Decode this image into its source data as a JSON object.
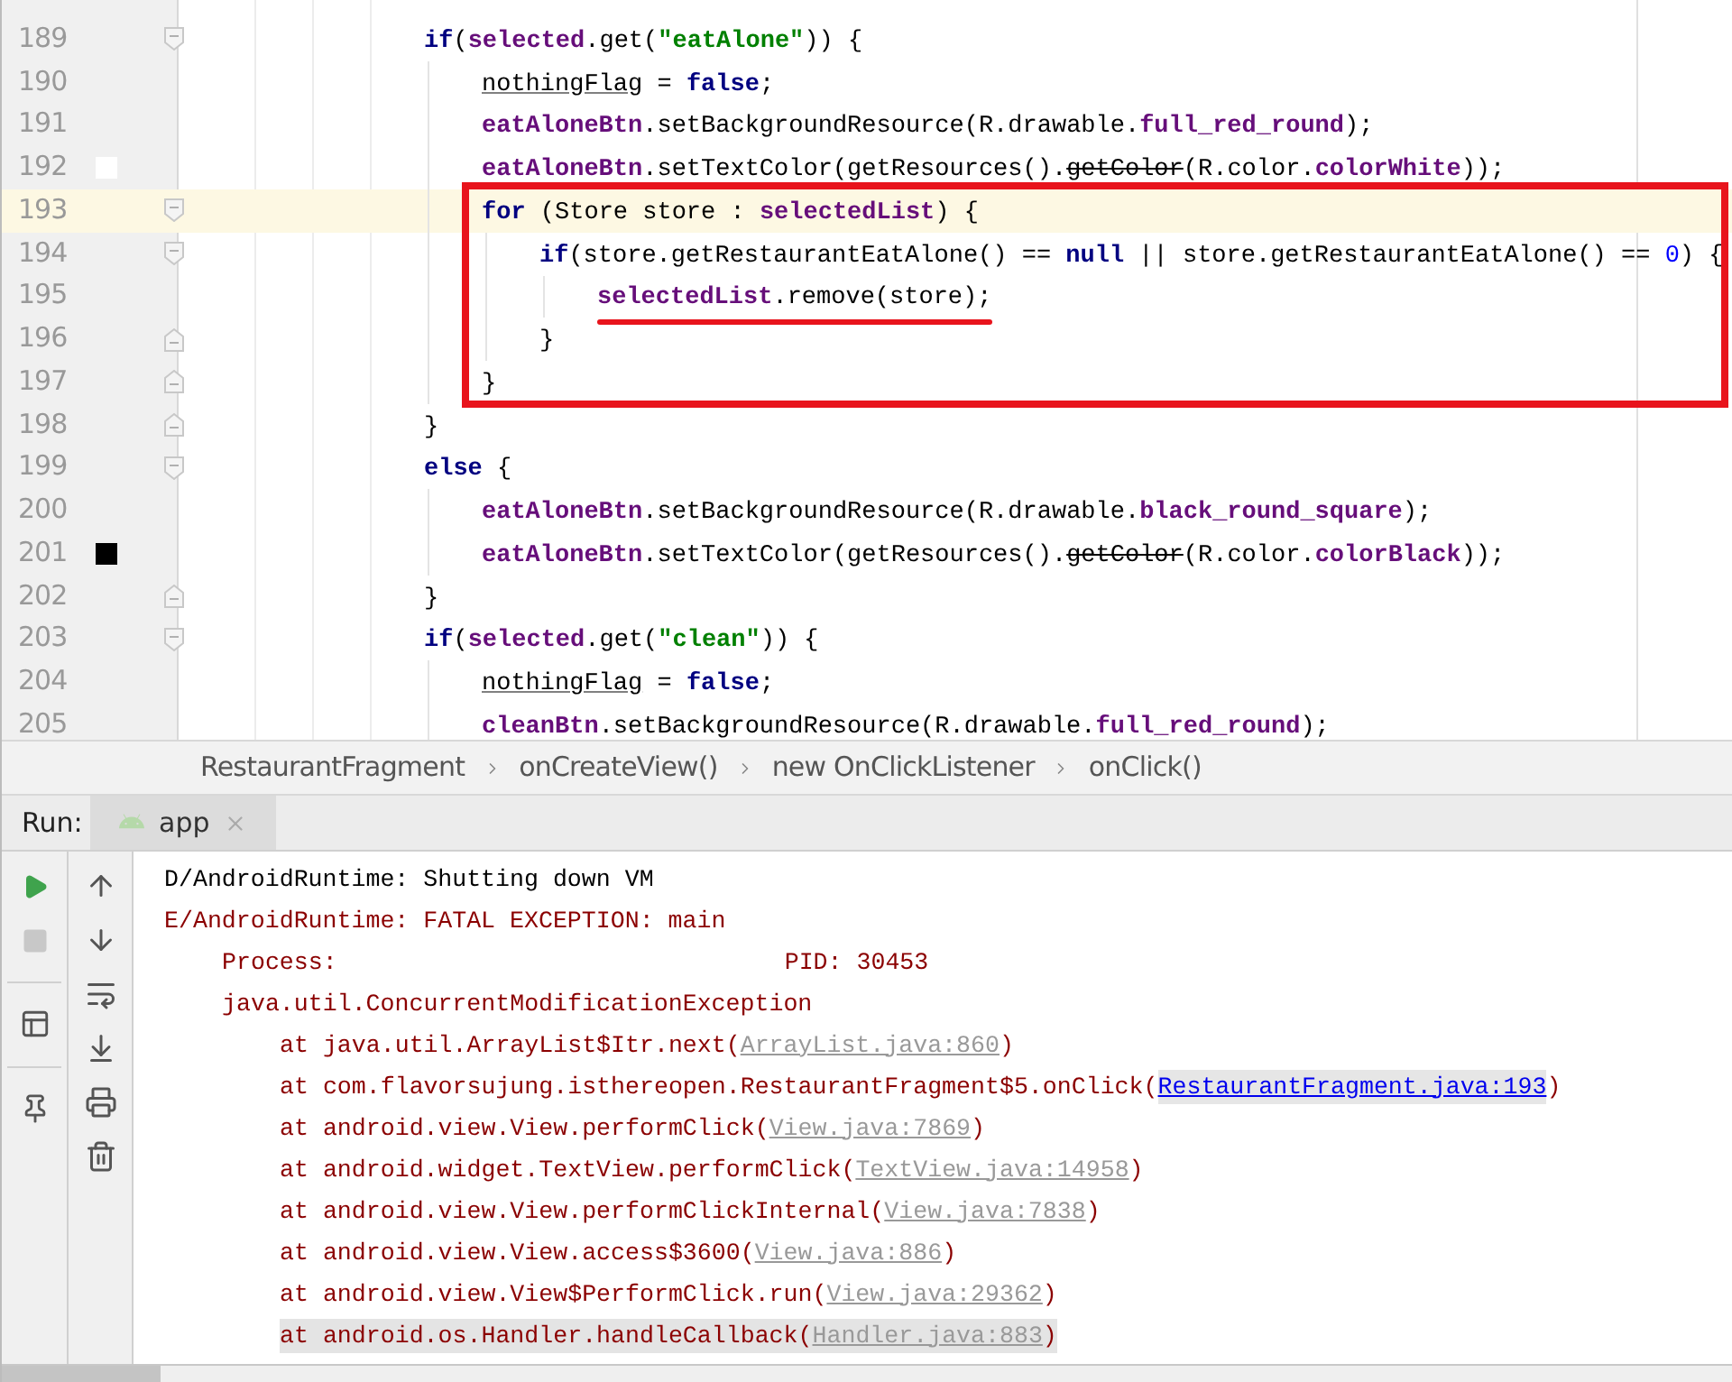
{
  "editor": {
    "lines": [
      {
        "number": "189",
        "fold_start": true,
        "tokens": [
          {
            "text": "if",
            "kind": "keyword"
          },
          {
            "text": "(",
            "kind": "plain"
          },
          {
            "text": "selected",
            "kind": "field"
          },
          {
            "text": ".get(",
            "kind": "plain"
          },
          {
            "text": "\"eatAlone\"",
            "kind": "string"
          },
          {
            "text": ")) {",
            "kind": "plain"
          }
        ],
        "children": [
          {
            "number": "190",
            "tokens": [
              {
                "text": "nothingFlag",
                "kind": "local"
              },
              {
                "text": " = ",
                "kind": "plain"
              },
              {
                "text": "false",
                "kind": "keyword"
              },
              {
                "text": ";",
                "kind": "plain"
              }
            ]
          },
          {
            "number": "191",
            "tokens": [
              {
                "text": "eatAloneBtn",
                "kind": "field"
              },
              {
                "text": ".setBackgroundResource(R.drawable.",
                "kind": "plain"
              },
              {
                "text": "full_red_round",
                "kind": "field"
              },
              {
                "text": ");",
                "kind": "plain"
              }
            ]
          },
          {
            "number": "192",
            "color": "#ffffff",
            "tokens": [
              {
                "text": "eatAloneBtn",
                "kind": "field"
              },
              {
                "text": ".setTextColor(getResources().",
                "kind": "plain"
              },
              {
                "text": "getColor",
                "kind": "deprecated"
              },
              {
                "text": "(R.color.",
                "kind": "plain"
              },
              {
                "text": "colorWhite",
                "kind": "field"
              },
              {
                "text": "));",
                "kind": "plain"
              }
            ]
          },
          {
            "number": "193",
            "fold_start": true,
            "current": true,
            "in_box": true,
            "tokens": [
              {
                "text": "for",
                "kind": "keyword"
              },
              {
                "text": " (Store store : ",
                "kind": "plain"
              },
              {
                "text": "selectedList",
                "kind": "field"
              },
              {
                "text": ") {",
                "kind": "plain"
              }
            ],
            "children": [
              {
                "number": "194",
                "fold_start": true,
                "in_box": true,
                "tokens": [
                  {
                    "text": "if",
                    "kind": "keyword"
                  },
                  {
                    "text": "(store.getRestaurantEatAlone() == ",
                    "kind": "plain"
                  },
                  {
                    "text": "null",
                    "kind": "keyword"
                  },
                  {
                    "text": " || store.getRestaurantEatAlone() == ",
                    "kind": "plain"
                  },
                  {
                    "text": "0",
                    "kind": "number"
                  },
                  {
                    "text": ") {",
                    "kind": "plain"
                  }
                ],
                "children": [
                  {
                    "number": "195",
                    "in_box": true,
                    "underlined": true,
                    "tokens": [
                      {
                        "text": "selectedList",
                        "kind": "field"
                      },
                      {
                        "text": ".remove(store);",
                        "kind": "plain"
                      }
                    ]
                  }
                ]
              },
              {
                "number": "196",
                "fold_end": true,
                "in_box": true,
                "tokens": [
                  {
                    "text": "}",
                    "kind": "plain"
                  }
                ]
              }
            ]
          },
          {
            "number": "197",
            "fold_end": true,
            "in_box": true,
            "tokens": [
              {
                "text": "}",
                "kind": "plain"
              }
            ]
          }
        ]
      },
      {
        "number": "198",
        "fold_end": true,
        "tokens": [
          {
            "text": "}",
            "kind": "plain"
          }
        ]
      },
      {
        "number": "199",
        "fold_start": true,
        "tokens": [
          {
            "text": "else",
            "kind": "keyword"
          },
          {
            "text": " {",
            "kind": "plain"
          }
        ],
        "children": [
          {
            "number": "200",
            "tokens": [
              {
                "text": "eatAloneBtn",
                "kind": "field"
              },
              {
                "text": ".setBackgroundResource(R.drawable.",
                "kind": "plain"
              },
              {
                "text": "black_round_square",
                "kind": "field"
              },
              {
                "text": ");",
                "kind": "plain"
              }
            ]
          },
          {
            "number": "201",
            "color": "#000000",
            "tokens": [
              {
                "text": "eatAloneBtn",
                "kind": "field"
              },
              {
                "text": ".setTextColor(getResources().",
                "kind": "plain"
              },
              {
                "text": "getColor",
                "kind": "deprecated"
              },
              {
                "text": "(R.color.",
                "kind": "plain"
              },
              {
                "text": "colorBlack",
                "kind": "field"
              },
              {
                "text": "));",
                "kind": "plain"
              }
            ]
          }
        ]
      },
      {
        "number": "202",
        "fold_end": true,
        "tokens": [
          {
            "text": "}",
            "kind": "plain"
          }
        ]
      },
      {
        "number": "203",
        "fold_start": true,
        "tokens": [
          {
            "text": "if",
            "kind": "keyword"
          },
          {
            "text": "(",
            "kind": "plain"
          },
          {
            "text": "selected",
            "kind": "field"
          },
          {
            "text": ".get(",
            "kind": "plain"
          },
          {
            "text": "\"clean\"",
            "kind": "string"
          },
          {
            "text": ")) {",
            "kind": "plain"
          }
        ],
        "children": [
          {
            "number": "204",
            "tokens": [
              {
                "text": "nothingFlag",
                "kind": "local"
              },
              {
                "text": " = ",
                "kind": "plain"
              },
              {
                "text": "false",
                "kind": "keyword"
              },
              {
                "text": ";",
                "kind": "plain"
              }
            ]
          },
          {
            "number": "205",
            "tokens": [
              {
                "text": "cleanBtn",
                "kind": "field"
              },
              {
                "text": ".setBackgroundResource(R.drawable.",
                "kind": "plain"
              },
              {
                "text": "full_red_round",
                "kind": "field"
              },
              {
                "text": ");",
                "kind": "plain"
              }
            ]
          }
        ]
      }
    ]
  },
  "breadcrumbs": [
    "RestaurantFragment",
    "onCreateView()",
    "new OnClickListener",
    "onClick()"
  ],
  "run_panel": {
    "label": "Run:",
    "tabs": [
      {
        "label": "app",
        "selected": true
      }
    ],
    "left_tools": [
      {
        "kind": "run",
        "disabled": false
      },
      {
        "kind": "stop",
        "disabled": true
      },
      {
        "kind": "layout",
        "disabled": false
      },
      {
        "kind": "pin",
        "disabled": false
      }
    ],
    "right_tools": [
      {
        "kind": "up"
      },
      {
        "kind": "down"
      },
      {
        "kind": "wrap"
      },
      {
        "kind": "scroll-end"
      },
      {
        "kind": "print"
      },
      {
        "kind": "delete"
      }
    ],
    "console": [
      {
        "kind": "info",
        "parts": [
          {
            "text": "D/AndroidRuntime: Shutting down VM",
            "kind": "text"
          }
        ]
      },
      {
        "kind": "error",
        "parts": [
          {
            "text": "E/AndroidRuntime: FATAL EXCEPTION: main",
            "kind": "text"
          }
        ],
        "children": [
          {
            "kind": "error",
            "parts": [
              {
                "text": "Process:",
                "kind": "text"
              },
              {
                "text": "PID: 30453",
                "kind": "tabbed"
              }
            ]
          },
          {
            "kind": "error",
            "parts": [
              {
                "text": "java.util.ConcurrentModificationException",
                "kind": "text"
              }
            ],
            "children": [
              {
                "kind": "error",
                "parts": [
                  {
                    "text": "at java.util.ArrayList$Itr.next(",
                    "kind": "text"
                  },
                  {
                    "text": "ArrayList.java:860",
                    "kind": "library-link"
                  },
                  {
                    "text": ")",
                    "kind": "text"
                  }
                ]
              },
              {
                "kind": "error",
                "parts": [
                  {
                    "text": "at com.flavorsujung.isthereopen.RestaurantFragment$5.onClick(",
                    "kind": "text"
                  },
                  {
                    "text": "RestaurantFragment.java:193",
                    "kind": "link"
                  },
                  {
                    "text": ")",
                    "kind": "text"
                  }
                ]
              },
              {
                "kind": "error",
                "parts": [
                  {
                    "text": "at android.view.View.performClick(",
                    "kind": "text"
                  },
                  {
                    "text": "View.java:7869",
                    "kind": "library-link"
                  },
                  {
                    "text": ")",
                    "kind": "text"
                  }
                ]
              },
              {
                "kind": "error",
                "parts": [
                  {
                    "text": "at android.widget.TextView.performClick(",
                    "kind": "text"
                  },
                  {
                    "text": "TextView.java:14958",
                    "kind": "library-link"
                  },
                  {
                    "text": ")",
                    "kind": "text"
                  }
                ]
              },
              {
                "kind": "error",
                "parts": [
                  {
                    "text": "at android.view.View.performClickInternal(",
                    "kind": "text"
                  },
                  {
                    "text": "View.java:7838",
                    "kind": "library-link"
                  },
                  {
                    "text": ")",
                    "kind": "text"
                  }
                ]
              },
              {
                "kind": "error",
                "parts": [
                  {
                    "text": "at android.view.View.access$3600(",
                    "kind": "text"
                  },
                  {
                    "text": "View.java:886",
                    "kind": "library-link"
                  },
                  {
                    "text": ")",
                    "kind": "text"
                  }
                ]
              },
              {
                "kind": "error",
                "parts": [
                  {
                    "text": "at android.view.View$PerformClick.run(",
                    "kind": "text"
                  },
                  {
                    "text": "View.java:29362",
                    "kind": "library-link"
                  },
                  {
                    "text": ")",
                    "kind": "text"
                  }
                ]
              },
              {
                "kind": "error",
                "selected": true,
                "parts": [
                  {
                    "text": "at android.os.Handler.handleCallback(",
                    "kind": "text"
                  },
                  {
                    "text": "Handler.java:883",
                    "kind": "library-link"
                  },
                  {
                    "text": ")",
                    "kind": "text"
                  }
                ]
              }
            ]
          }
        ]
      }
    ]
  }
}
